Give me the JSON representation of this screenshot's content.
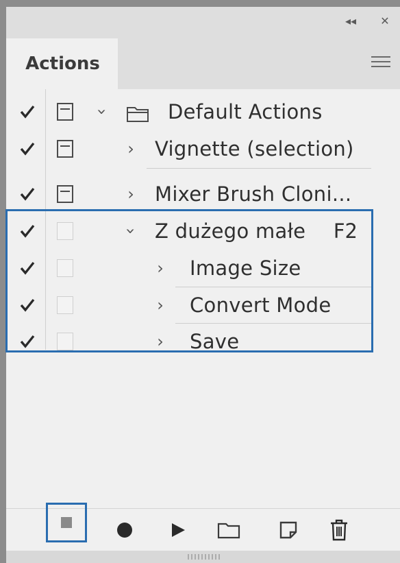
{
  "panel": {
    "tab_label": "Actions",
    "title_buttons": {
      "collapse_glyph": "◂◂",
      "close_glyph": "✕"
    }
  },
  "actions": [
    {
      "label": "Default Actions",
      "type": "set",
      "expanded": true,
      "checked": true,
      "dialog": true,
      "shortcut": ""
    },
    {
      "label": "Vignette (selection)",
      "type": "action",
      "expanded": false,
      "checked": true,
      "dialog": true,
      "shortcut": ""
    },
    {
      "label": "Mixer Brush Cloni...",
      "type": "action",
      "expanded": false,
      "checked": true,
      "dialog": true,
      "shortcut": ""
    },
    {
      "label": "Z dużego małe",
      "type": "action",
      "expanded": true,
      "checked": true,
      "dialog": false,
      "shortcut": "F2"
    },
    {
      "label": "Image Size",
      "type": "step",
      "expanded": false,
      "checked": true,
      "dialog": false,
      "shortcut": ""
    },
    {
      "label": "Convert Mode",
      "type": "step",
      "expanded": false,
      "checked": true,
      "dialog": false,
      "shortcut": ""
    },
    {
      "label": "Save",
      "type": "step",
      "expanded": false,
      "checked": true,
      "dialog": false,
      "shortcut": ""
    }
  ],
  "footer": {
    "buttons": [
      "stop-icon",
      "record-icon",
      "play-icon",
      "folder-icon",
      "new-action-icon",
      "trash-icon"
    ]
  },
  "colors": {
    "highlight": "#2a6db0",
    "panel_bg": "#f0f0f0",
    "titlebar_bg": "#dedede"
  }
}
